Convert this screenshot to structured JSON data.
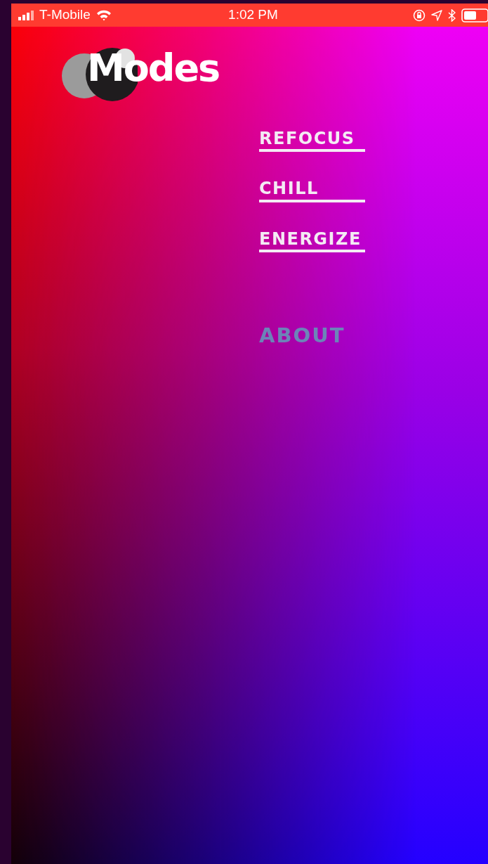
{
  "status_bar": {
    "carrier": "T-Mobile",
    "time": "1:02 PM"
  },
  "logo": {
    "text": "Modes"
  },
  "menu": [
    {
      "label": "REFOCUS",
      "kind": "mode"
    },
    {
      "label": "CHILL",
      "kind": "mode"
    },
    {
      "label": "ENERGIZE",
      "kind": "mode"
    },
    {
      "label": "ABOUT",
      "kind": "link"
    }
  ]
}
